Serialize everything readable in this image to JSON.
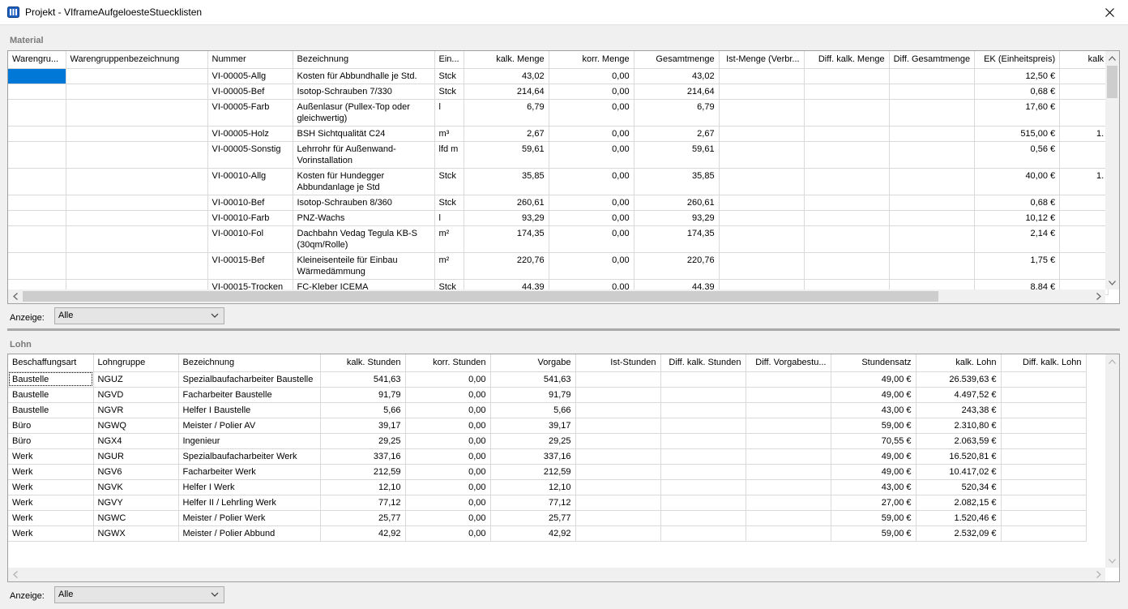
{
  "window": {
    "title": "Projekt - VIframeAufgeloesteStuecklisten"
  },
  "material": {
    "section_label": "Material",
    "columns": [
      "Warengru...",
      "Warengruppenbezeichnung",
      "Nummer",
      "Bezeichnung",
      "Ein...",
      "kalk. Menge",
      "korr. Menge",
      "Gesamtmenge",
      "Ist-Menge (Verbr...",
      "Diff. kalk. Menge",
      "Diff. Gesamtmenge",
      "EK (Einheitspreis)",
      "kalk"
    ],
    "rows": [
      [
        "",
        "",
        "VI-00005-Allg",
        "Kosten für Abbundhalle je Std.",
        "Stck",
        "43,02",
        "0,00",
        "43,02",
        "",
        "",
        "",
        "12,50 €",
        ""
      ],
      [
        "",
        "",
        "VI-00005-Bef",
        "Isotop-Schrauben 7/330",
        "Stck",
        "214,64",
        "0,00",
        "214,64",
        "",
        "",
        "",
        "0,68 €",
        ""
      ],
      [
        "",
        "",
        "VI-00005-Farb",
        "Außenlasur (Pullex-Top oder gleichwertig)",
        "l",
        "6,79",
        "0,00",
        "6,79",
        "",
        "",
        "",
        "17,60 €",
        ""
      ],
      [
        "",
        "",
        "VI-00005-Holz",
        "BSH Sichtqualität C24",
        "m³",
        "2,67",
        "0,00",
        "2,67",
        "",
        "",
        "",
        "515,00 €",
        "1."
      ],
      [
        "",
        "",
        "VI-00005-Sonstig",
        "Lehrrohr für Außenwand-Vorinstallation",
        "lfd m",
        "59,61",
        "0,00",
        "59,61",
        "",
        "",
        "",
        "0,56 €",
        ""
      ],
      [
        "",
        "",
        "VI-00010-Allg",
        "Kosten für Hundegger Abbundanlage je Std",
        "Stck",
        "35,85",
        "0,00",
        "35,85",
        "",
        "",
        "",
        "40,00 €",
        "1."
      ],
      [
        "",
        "",
        "VI-00010-Bef",
        "Isotop-Schrauben 8/360",
        "Stck",
        "260,61",
        "0,00",
        "260,61",
        "",
        "",
        "",
        "0,68 €",
        ""
      ],
      [
        "",
        "",
        "VI-00010-Farb",
        "PNZ-Wachs",
        "l",
        "93,29",
        "0,00",
        "93,29",
        "",
        "",
        "",
        "10,12 €",
        ""
      ],
      [
        "",
        "",
        "VI-00010-Fol",
        "Dachbahn Vedag Tegula KB-S (30qm/Rolle)",
        "m²",
        "174,35",
        "0,00",
        "174,35",
        "",
        "",
        "",
        "2,14 €",
        ""
      ],
      [
        "",
        "",
        "VI-00015-Bef",
        "Kleineisenteile für Einbau Wärmedämmung",
        "m²",
        "220,76",
        "0,00",
        "220,76",
        "",
        "",
        "",
        "1,75 €",
        ""
      ],
      [
        "",
        "",
        "VI-00015-Trocken",
        "FC-Kleber ICEMA",
        "Stck",
        "44,39",
        "0,00",
        "44,39",
        "",
        "",
        "",
        "8,84 €",
        ""
      ]
    ],
    "filter_label": "Anzeige:",
    "filter_value": "Alle"
  },
  "lohn": {
    "section_label": "Lohn",
    "columns": [
      "Beschaffungsart",
      "Lohngruppe",
      "Bezeichnung",
      "kalk. Stunden",
      "korr. Stunden",
      "Vorgabe",
      "Ist-Stunden",
      "Diff. kalk. Stunden",
      "Diff. Vorgabestu...",
      "Stundensatz",
      "kalk. Lohn",
      "Diff. kalk. Lohn"
    ],
    "rows": [
      [
        "Baustelle",
        "NGUZ",
        "Spezialbaufacharbeiter Baustelle",
        "541,63",
        "0,00",
        "541,63",
        "",
        "",
        "",
        "49,00 €",
        "26.539,63 €",
        ""
      ],
      [
        "Baustelle",
        "NGVD",
        "Facharbeiter Baustelle",
        "91,79",
        "0,00",
        "91,79",
        "",
        "",
        "",
        "49,00 €",
        "4.497,52 €",
        ""
      ],
      [
        "Baustelle",
        "NGVR",
        "Helfer I Baustelle",
        "5,66",
        "0,00",
        "5,66",
        "",
        "",
        "",
        "43,00 €",
        "243,38 €",
        ""
      ],
      [
        "Büro",
        "NGWQ",
        "Meister / Polier AV",
        "39,17",
        "0,00",
        "39,17",
        "",
        "",
        "",
        "59,00 €",
        "2.310,80 €",
        ""
      ],
      [
        "Büro",
        "NGX4",
        "Ingenieur",
        "29,25",
        "0,00",
        "29,25",
        "",
        "",
        "",
        "70,55 €",
        "2.063,59 €",
        ""
      ],
      [
        "Werk",
        "NGUR",
        "Spezialbaufacharbeiter Werk",
        "337,16",
        "0,00",
        "337,16",
        "",
        "",
        "",
        "49,00 €",
        "16.520,81 €",
        ""
      ],
      [
        "Werk",
        "NGV6",
        "Facharbeiter Werk",
        "212,59",
        "0,00",
        "212,59",
        "",
        "",
        "",
        "49,00 €",
        "10.417,02 €",
        ""
      ],
      [
        "Werk",
        "NGVK",
        "Helfer I Werk",
        "12,10",
        "0,00",
        "12,10",
        "",
        "",
        "",
        "43,00 €",
        "520,34 €",
        ""
      ],
      [
        "Werk",
        "NGVY",
        "Helfer II / Lehrling Werk",
        "77,12",
        "0,00",
        "77,12",
        "",
        "",
        "",
        "27,00 €",
        "2.082,15 €",
        ""
      ],
      [
        "Werk",
        "NGWC",
        "Meister / Polier Werk",
        "25,77",
        "0,00",
        "25,77",
        "",
        "",
        "",
        "59,00 €",
        "1.520,46 €",
        ""
      ],
      [
        "Werk",
        "NGWX",
        "Meister / Polier Abbund",
        "42,92",
        "0,00",
        "42,92",
        "",
        "",
        "",
        "59,00 €",
        "2.532,09 €",
        ""
      ]
    ],
    "filter_label": "Anzeige:",
    "filter_value": "Alle"
  },
  "colors": {
    "selection": "#0078d7",
    "grid_line": "#d9d9d9",
    "section_label": "#7a7a7a"
  }
}
